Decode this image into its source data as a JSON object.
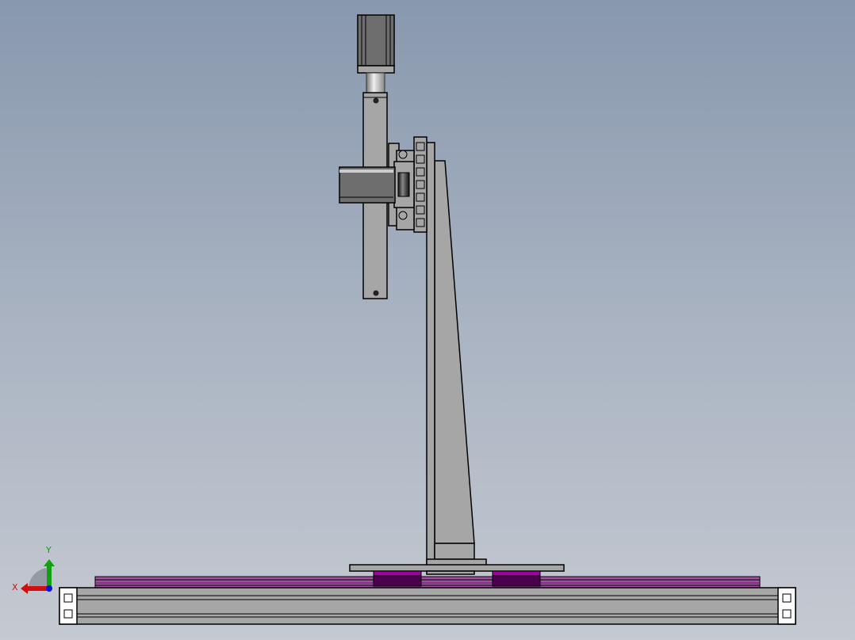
{
  "viewport": {
    "background_top": "#8898ae",
    "background_bottom": "#c5c9d1"
  },
  "triad": {
    "x_label": "X",
    "y_label": "Y",
    "x_color": "#e01010",
    "y_color": "#10a010",
    "z_color": "#1010e0"
  },
  "colors": {
    "part": "#a6a6a6",
    "slider_top": "#a000a0",
    "slider_body": "#4a004a",
    "rail": "#a050a0"
  }
}
